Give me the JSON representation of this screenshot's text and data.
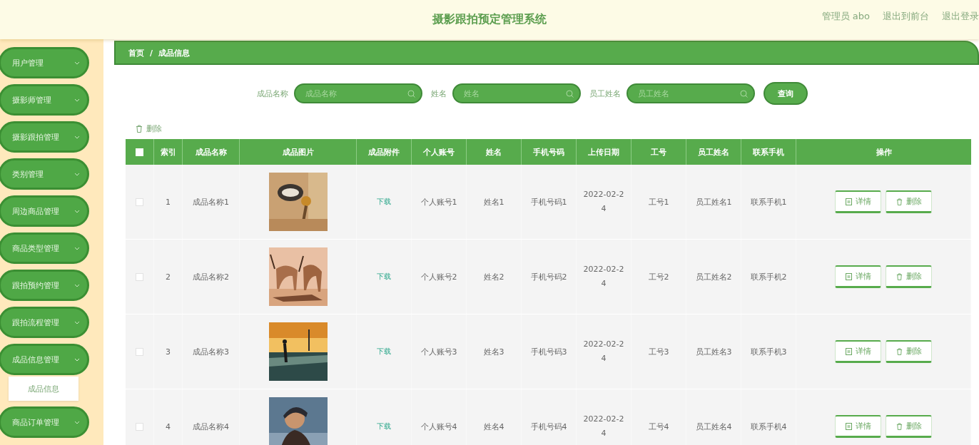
{
  "header": {
    "title": "摄影跟拍预定管理系统",
    "links": [
      "管理员 abo",
      "退出到前台",
      "退出登录"
    ]
  },
  "sidebar": {
    "items": [
      {
        "label": "用户管理",
        "expanded": false
      },
      {
        "label": "摄影师管理",
        "expanded": false
      },
      {
        "label": "摄影跟拍管理",
        "expanded": false
      },
      {
        "label": "类别管理",
        "expanded": false
      },
      {
        "label": "周边商品管理",
        "expanded": false
      },
      {
        "label": "商品类型管理",
        "expanded": false
      },
      {
        "label": "跟拍预约管理",
        "expanded": false
      },
      {
        "label": "跟拍流程管理",
        "expanded": false
      },
      {
        "label": "成品信息管理",
        "expanded": true,
        "children": [
          {
            "label": "成品信息",
            "selected": true
          }
        ]
      },
      {
        "label": "商品订单管理",
        "expanded": false
      }
    ]
  },
  "breadcrumb": {
    "items": [
      "首页",
      "成品信息"
    ],
    "separator": "/"
  },
  "search": {
    "fields": [
      {
        "label": "成品名称",
        "placeholder": "成品名称"
      },
      {
        "label": "姓名",
        "placeholder": "姓名"
      },
      {
        "label": "员工姓名",
        "placeholder": "员工姓名"
      }
    ],
    "button": "查询"
  },
  "toolbar": {
    "delete": "删除"
  },
  "table": {
    "header_checked": false,
    "columns": [
      "索引",
      "成品名称",
      "成品图片",
      "成品附件",
      "个人账号",
      "姓名",
      "手机号码",
      "上传日期",
      "工号",
      "员工姓名",
      "联系手机",
      "操作"
    ],
    "rows": [
      {
        "checked": false,
        "cells": [
          "1",
          "成品名称1",
          {
            "kind": "picture"
          },
          "下载",
          "个人账号1",
          "姓名1",
          "手机号码1",
          "2022-02-24",
          "工号1",
          "员工姓名1",
          "联系手机1"
        ],
        "actions": [
          "详情",
          "删除"
        ]
      },
      {
        "checked": false,
        "cells": [
          "2",
          "成品名称2",
          {
            "kind": "picture"
          },
          "下载",
          "个人账号2",
          "姓名2",
          "手机号码2",
          "2022-02-24",
          "工号2",
          "员工姓名2",
          "联系手机2"
        ],
        "actions": [
          "详情",
          "删除"
        ]
      },
      {
        "checked": false,
        "cells": [
          "3",
          "成品名称3",
          {
            "kind": "picture"
          },
          "下载",
          "个人账号3",
          "姓名3",
          "手机号码3",
          "2022-02-24",
          "工号3",
          "员工姓名3",
          "联系手机3"
        ],
        "actions": [
          "详情",
          "删除"
        ]
      },
      {
        "checked": false,
        "cells": [
          "4",
          "成品名称4",
          {
            "kind": "picture"
          },
          "下载",
          "个人账号4",
          "姓名4",
          "手机号码4",
          "2022-02-24",
          "工号4",
          "员工姓名4",
          "联系手机4"
        ],
        "actions": [
          "详情",
          "删除"
        ]
      }
    ]
  }
}
